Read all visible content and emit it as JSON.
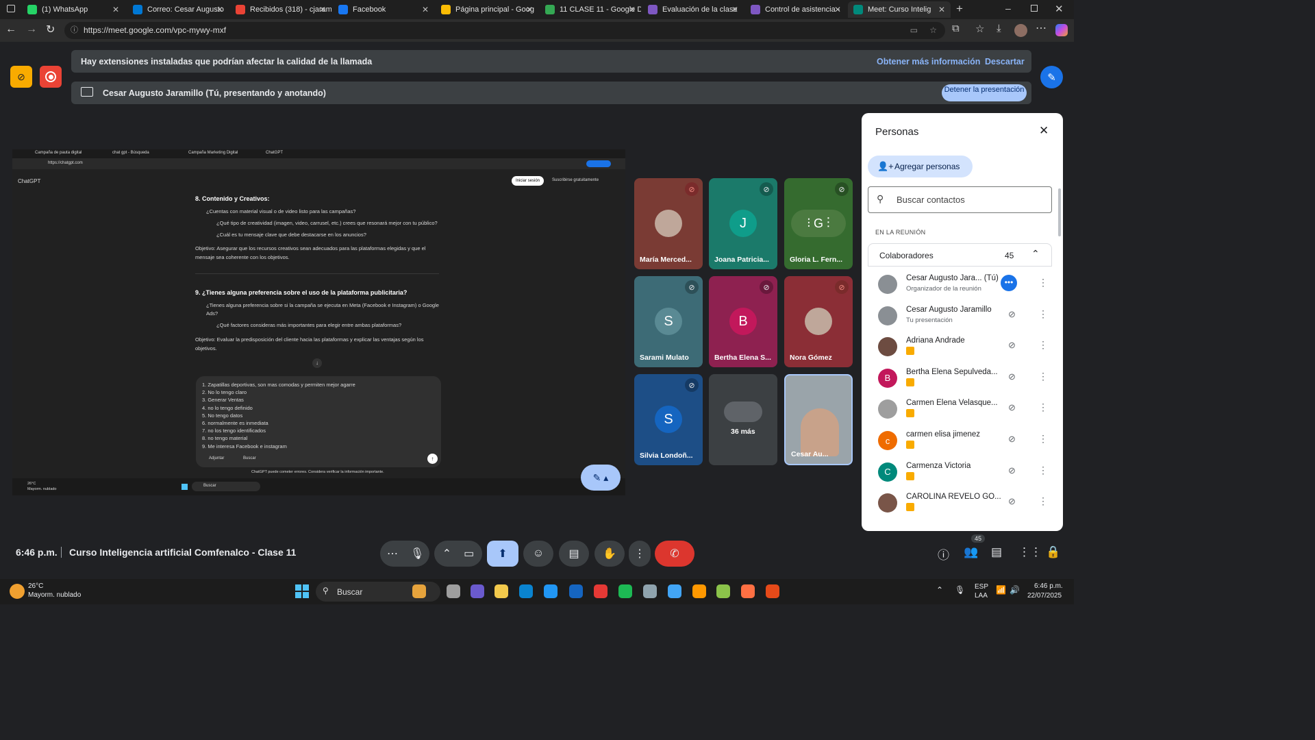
{
  "browser": {
    "tabs": [
      {
        "label": "(1) WhatsApp",
        "color": "#25d366"
      },
      {
        "label": "Correo: Cesar Augusto",
        "color": "#0078d4"
      },
      {
        "label": "Recibidos (318) - cjaram",
        "color": "#ea4335"
      },
      {
        "label": "Facebook",
        "color": "#1877f2"
      },
      {
        "label": "Página principal - Goog",
        "color": "#fbbc04"
      },
      {
        "label": "11 CLASE 11 - Google D",
        "color": "#34a853"
      },
      {
        "label": "Evaluación de la clase",
        "color": "#7e57c2"
      },
      {
        "label": "Control de asistencia -",
        "color": "#7e57c2"
      },
      {
        "label": "Meet: Curso Intelig",
        "color": "#00897b"
      }
    ],
    "url": "https://meet.google.com/vpc-mywy-mxf"
  },
  "meet": {
    "banner_ext": "Hay extensiones instaladas que podrían afectar la calidad de la llamada",
    "banner_more": "Obtener más información",
    "banner_dismiss": "Descartar",
    "presenting": "Cesar Augusto Jaramillo (Tú, presentando y anotando)",
    "stop_presenting": "Detener la presentación",
    "time": "6:46 p.m.",
    "meeting_title": "Curso Inteligencia artificial Comfenalco - Clase 11",
    "people_count": "45",
    "tiles": [
      {
        "name": "María Merced...",
        "initial": "",
        "bg": "#7a3b34",
        "mic": "off-red"
      },
      {
        "name": "Joana Patricia...",
        "initial": "J",
        "bg": "#1b7a6a",
        "mic": "off"
      },
      {
        "name": "Gloria L. Fern...",
        "initial": "",
        "bg": "#356b2f",
        "mic": "off"
      },
      {
        "name": "Sarami Mulato",
        "initial": "S",
        "bg": "#3d6b76",
        "mic": "off"
      },
      {
        "name": "Bertha Elena S...",
        "initial": "B",
        "bg": "#8e2150",
        "mic": "off"
      },
      {
        "name": "Nora Gómez",
        "initial": "",
        "bg": "#8b2e36",
        "mic": "off-red"
      },
      {
        "name": "Silvia Londoñ...",
        "initial": "S",
        "bg": "#1d4e86",
        "mic": "off"
      },
      {
        "name": "36 más",
        "initial": "",
        "bg": "#3c4043",
        "mic": ""
      },
      {
        "name": "Cesar Au...",
        "initial": "",
        "bg": "#9aa4aa",
        "mic": ""
      }
    ]
  },
  "panel": {
    "title": "Personas",
    "add": "Agregar personas",
    "search_placeholder": "Buscar contactos",
    "section": "EN LA REUNIÓN",
    "group": "Colaboradores",
    "group_count": "45",
    "people": [
      {
        "name": "Cesar Augusto Jara... (Tú)",
        "sub": "Organizador de la reunión",
        "initial": "",
        "color": "#8a8f94"
      },
      {
        "name": "Cesar Augusto Jaramillo",
        "sub": "Tu presentación",
        "initial": "",
        "color": "#8a8f94"
      },
      {
        "name": "Adriana Andrade",
        "sub": "",
        "initial": "",
        "color": "#6d4c41"
      },
      {
        "name": "Bertha Elena Sepulveda...",
        "sub": "",
        "initial": "B",
        "color": "#c2185b"
      },
      {
        "name": "Carmen Elena Velasque...",
        "sub": "",
        "initial": "",
        "color": "#9e9e9e"
      },
      {
        "name": "carmen elisa jimenez",
        "sub": "",
        "initial": "c",
        "color": "#ef6c00"
      },
      {
        "name": "Carmenza Victoria",
        "sub": "",
        "initial": "C",
        "color": "#00897b"
      },
      {
        "name": "CAROLINA REVELO GO...",
        "sub": "",
        "initial": "",
        "color": "#795548"
      }
    ]
  },
  "shared": {
    "tabs": [
      "Campaña de pauta digital",
      "chat gpt - Búsqueda",
      "Campaña Marketing Digital",
      "ChatGPT"
    ],
    "url": "https://chatgpt.com",
    "app": "ChatGPT",
    "login": "Iniciar sesión",
    "signup": "Suscribirse gratuitamente",
    "h8": "8. Contenido y Creativos:",
    "q8a": "¿Cuentas con material visual o de video listo para las campañas?",
    "q8b": "¿Qué tipo de creatividad (imagen, video, carrusel, etc.) crees que resonará mejor con tu público?",
    "q8c": "¿Cuál es tu mensaje clave que debe destacarse en los anuncios?",
    "obj8a": "Objetivo: Asegurar que los recursos creativos sean adecuados para las plataformas elegidas y que el",
    "obj8b": "mensaje sea coherente con los objetivos.",
    "h9": "9. ¿Tienes alguna preferencia sobre el uso de la plataforma publicitaria?",
    "q9a": "¿Tienes alguna preferencia sobre si la campaña se ejecuta en Meta (Facebook e Instagram) o Google",
    "q9a2": "Ads?",
    "q9b": "¿Qué factores consideras más importantes para elegir entre ambas plataformas?",
    "obj9a": "Objetivo: Evaluar la predisposición del cliente hacia las plataformas y explicar las ventajas según los",
    "obj9b": "objetivos.",
    "answers": [
      "1. Zapatillas deportivas,  son mas comodas y permiten mejor agarre",
      "2. No lo tengo claro",
      "3. Generar Ventas",
      "4. no lo tengo definido",
      "5. No tengo datos",
      "6. normalmente es inmediata",
      "7. no los tengo identificados",
      "8. no tengo material",
      "9. Me interesa Facebook e instagram"
    ],
    "attach": "Adjuntar",
    "search": "Buscar",
    "disclaimer": "ChatGPT puede cometer errores. Considera verificar la información importante.",
    "weather": "26°C",
    "weather2": "Mayorm. nublado",
    "taskbar_search": "Buscar"
  },
  "taskbar": {
    "temp": "26°C",
    "weather": "Mayorm. nublado",
    "search": "Buscar",
    "lang1": "ESP",
    "lang2": "LAA",
    "time": "6:46 p.m.",
    "date": "22/07/2025"
  }
}
